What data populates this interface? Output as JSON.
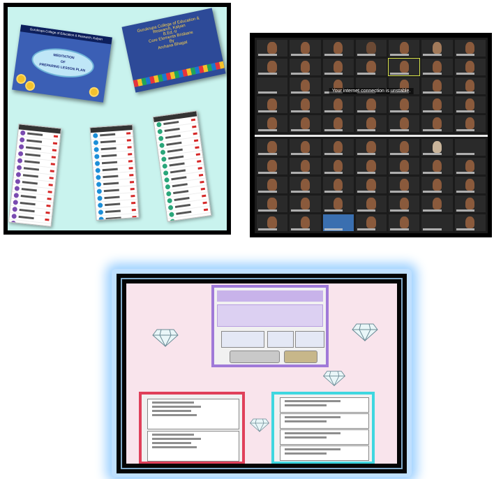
{
  "collage": {
    "slide_top_left": {
      "header": "Gurukrupa College of Education & Research, Kalyan",
      "oval_text_1": "MEDITATION",
      "oval_text_2": "OF",
      "oval_text_3": "PREPARING LESSON PLAN"
    },
    "slide_top_right": {
      "line1": "Gurukrupa College of Education &",
      "line2": "Research, Kalyan",
      "line3": "B.Ed.-II",
      "line4": "Core Elements Brisbane",
      "line5": "By",
      "line6": "Archana Bhagat"
    }
  },
  "meeting": {
    "warning_text": "Your internet connection is unstable."
  },
  "colors": {
    "collage_bg": "#c9f3ee",
    "board_bg": "#f9e4ec",
    "purple_frame": "#a07ad8",
    "red_frame": "#e0405a",
    "cyan_frame": "#3fd7e0",
    "glow": "#9cd0ff"
  },
  "icons": [
    "diamond-icon",
    "microphone-muted-icon",
    "avatar-icon"
  ]
}
